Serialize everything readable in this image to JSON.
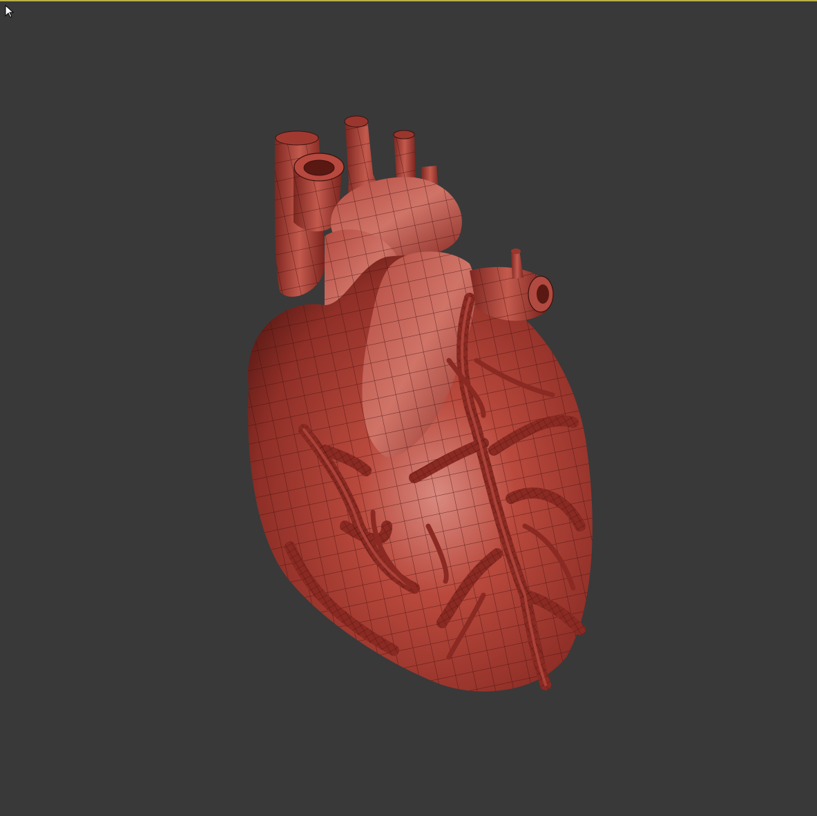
{
  "viewport": {
    "background_color": "#393939",
    "frame_color": "#b9b04a"
  },
  "cursor": {
    "icon": "arrow-pointer-icon"
  },
  "model": {
    "subject": "heart-3d-model",
    "material_color": "#b5473c",
    "highlight_color": "#d98a80",
    "shadow_color": "#6a1f1a",
    "wireframe_color": "#3b0f0c"
  }
}
